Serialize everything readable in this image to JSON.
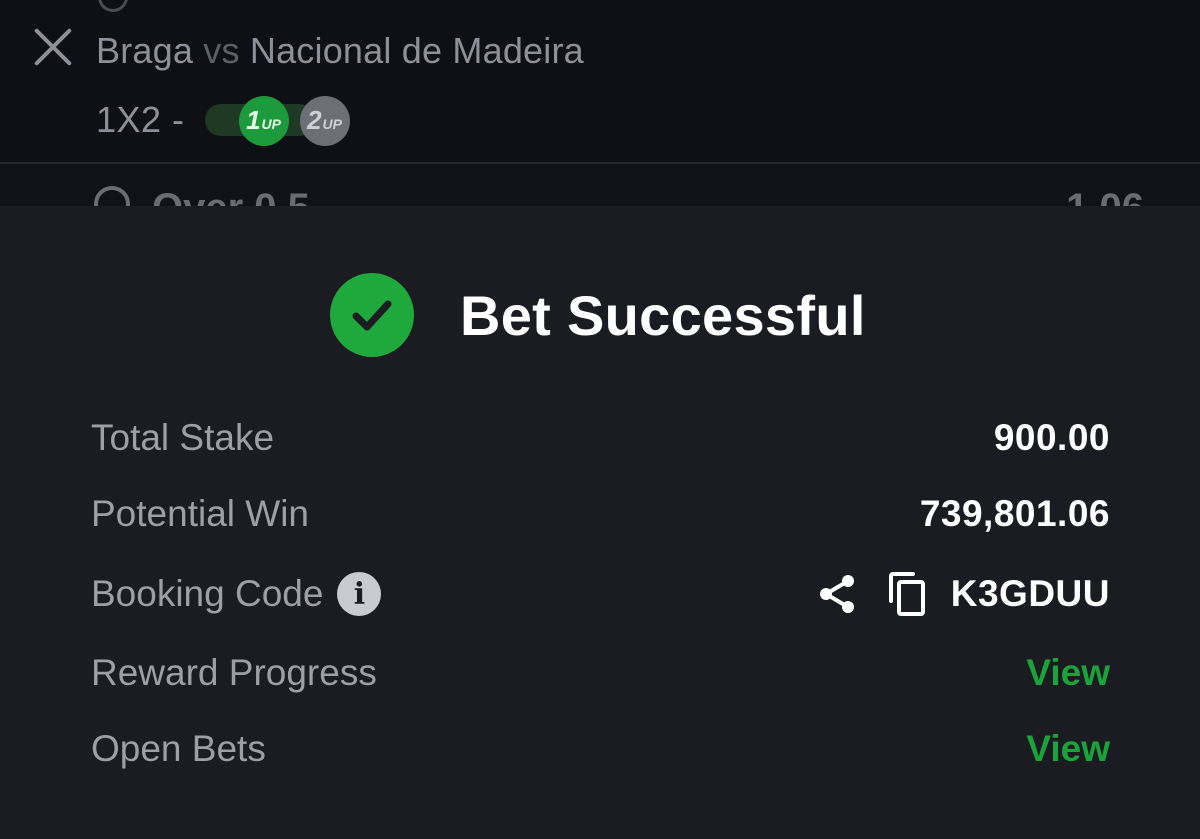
{
  "betslip": {
    "team_home": "Braga",
    "vs": "vs",
    "team_away": "Nacional de Madeira",
    "market": "1X2 -",
    "boost_one": {
      "num": "1",
      "suffix": "UP"
    },
    "boost_two": {
      "num": "2",
      "suffix": "UP"
    },
    "selection": "Over 0.5",
    "odds": "1.06"
  },
  "success": {
    "title": "Bet Successful",
    "icon": "check-circle-icon",
    "accent": "#1fa83c"
  },
  "summary": {
    "total_stake_label": "Total Stake",
    "total_stake_value": "900.00",
    "potential_win_label": "Potential Win",
    "potential_win_value": "739,801.06",
    "booking_code_label": "Booking Code",
    "booking_code_value": "K3GDUU",
    "reward_progress_label": "Reward Progress",
    "reward_progress_link": "View",
    "open_bets_label": "Open Bets",
    "open_bets_link": "View"
  }
}
